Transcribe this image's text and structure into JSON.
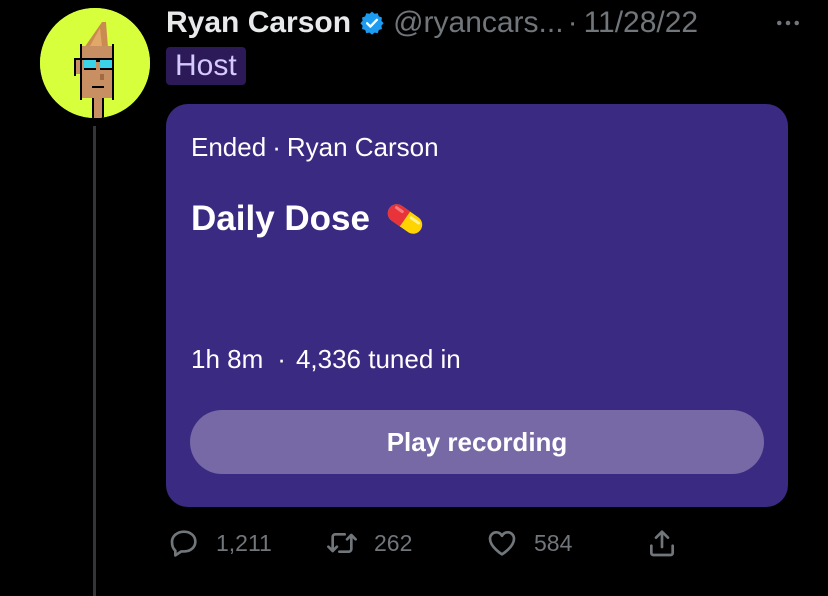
{
  "author": {
    "display_name": "Ryan Carson",
    "handle": "@ryancars...",
    "separator": "·",
    "date": "11/28/22",
    "badge": "Host",
    "avatar_icon": "pixel-punk-avatar",
    "verified_icon": "verified-badge-icon"
  },
  "space_card": {
    "status": "Ended",
    "meta_separator": "·",
    "host_name": "Ryan Carson",
    "title": "Daily Dose",
    "title_emoji_icon": "pill-icon",
    "duration": "1h 8m",
    "stats_separator": "·",
    "listeners": "4,336 tuned in",
    "button_label": "Play recording"
  },
  "actions": {
    "reply_count": "1,211",
    "retweet_count": "262",
    "like_count": "584",
    "share_icon": "share-icon"
  },
  "colors": {
    "background": "#000000",
    "card": "#3b2a81",
    "button": "#7669a6",
    "host_badge_bg": "#2b1a57",
    "muted_text": "#71767b",
    "verified": "#1d9bf0",
    "avatar_bg": "#d7ff3c"
  }
}
